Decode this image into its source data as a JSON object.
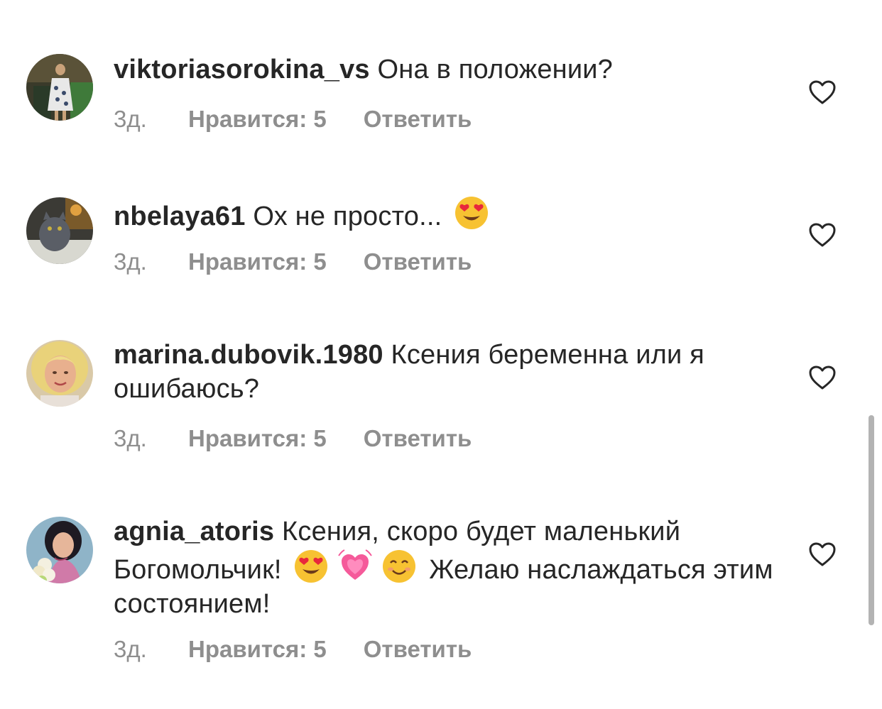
{
  "comments": [
    {
      "username": "viktoriasorokina_vs",
      "text": "Она в положении?",
      "time": "3д.",
      "likes": "Нравится: 5",
      "reply": "Ответить",
      "avatar_icon": "avatar-photo-woman-dress"
    },
    {
      "username": "nbelaya61",
      "text": "Ох не просто...",
      "text_emoji": "heart-eyes-emoji",
      "time": "3д.",
      "likes": "Нравится: 5",
      "reply": "Ответить",
      "avatar_icon": "avatar-photo-cat"
    },
    {
      "username": "marina.dubovik.1980",
      "text": "Ксения беременна или я ошибаюсь?",
      "time": "3д.",
      "likes": "Нравится: 5",
      "reply": "Ответить",
      "avatar_icon": "avatar-photo-blonde-woman"
    },
    {
      "username": "agnia_atoris",
      "text_part1": "Ксения, скоро будет маленький Богомольчик!",
      "text_part2": "Желаю наслаждаться этим состоянием!",
      "emojis": [
        "heart-eyes-emoji",
        "growing-heart-emoji",
        "smiling-face-emoji"
      ],
      "time": "3д.",
      "likes": "Нравится: 5",
      "reply": "Ответить",
      "avatar_icon": "avatar-photo-woman-flowers"
    }
  ],
  "colors": {
    "text": "#262626",
    "meta": "#8e8e8e",
    "heart_outline": "#262626",
    "scrollbar": "#b3b3b3"
  }
}
